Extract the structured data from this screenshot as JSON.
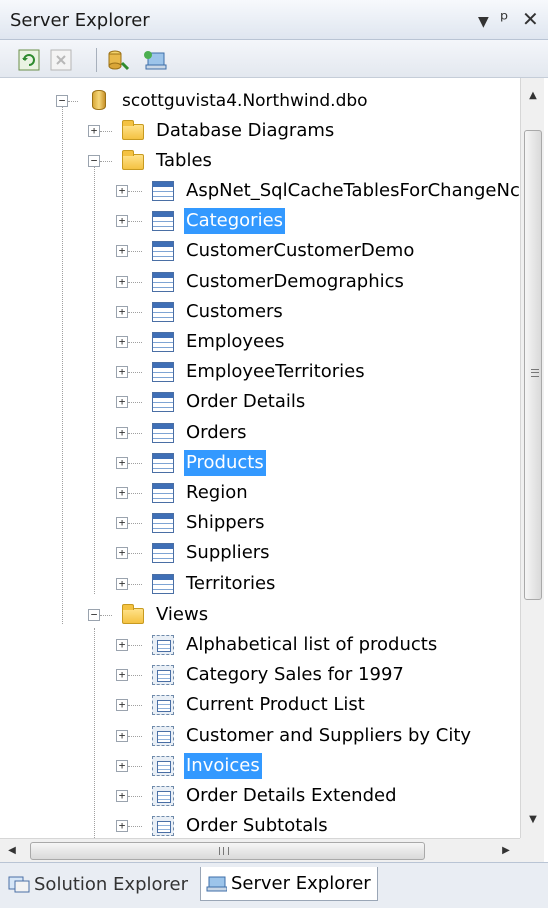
{
  "window": {
    "title": "Server Explorer",
    "controls": [
      "dropdown-icon",
      "pin-icon",
      "close-icon"
    ]
  },
  "toolbar": {
    "buttons": [
      "refresh-icon",
      "stop-refresh-icon",
      "connect-to-database-icon",
      "connect-to-server-icon"
    ]
  },
  "tree": {
    "database": "scottguvista4.Northwind.dbo",
    "folders": {
      "diagrams": "Database Diagrams",
      "tables": "Tables",
      "views": "Views"
    },
    "tables": [
      "AspNet_SqlCacheTablesForChangeNc",
      "Categories",
      "CustomerCustomerDemo",
      "CustomerDemographics",
      "Customers",
      "Employees",
      "EmployeeTerritories",
      "Order Details",
      "Orders",
      "Products",
      "Region",
      "Shippers",
      "Suppliers",
      "Territories"
    ],
    "views": [
      "Alphabetical list of products",
      "Category Sales for 1997",
      "Current Product List",
      "Customer and Suppliers by City",
      "Invoices",
      "Order Details Extended",
      "Order Subtotals"
    ],
    "selected": [
      "Categories",
      "Products",
      "Invoices"
    ]
  },
  "scrollbars": {
    "horizontal_grip": "III",
    "vertical_grip": "≡"
  },
  "tabs": [
    {
      "label": "Solution Explorer",
      "active": false
    },
    {
      "label": "Server Explorer",
      "active": true
    }
  ],
  "colors": {
    "selection": "#3399ff",
    "titlebar": "#dfe6f0"
  }
}
